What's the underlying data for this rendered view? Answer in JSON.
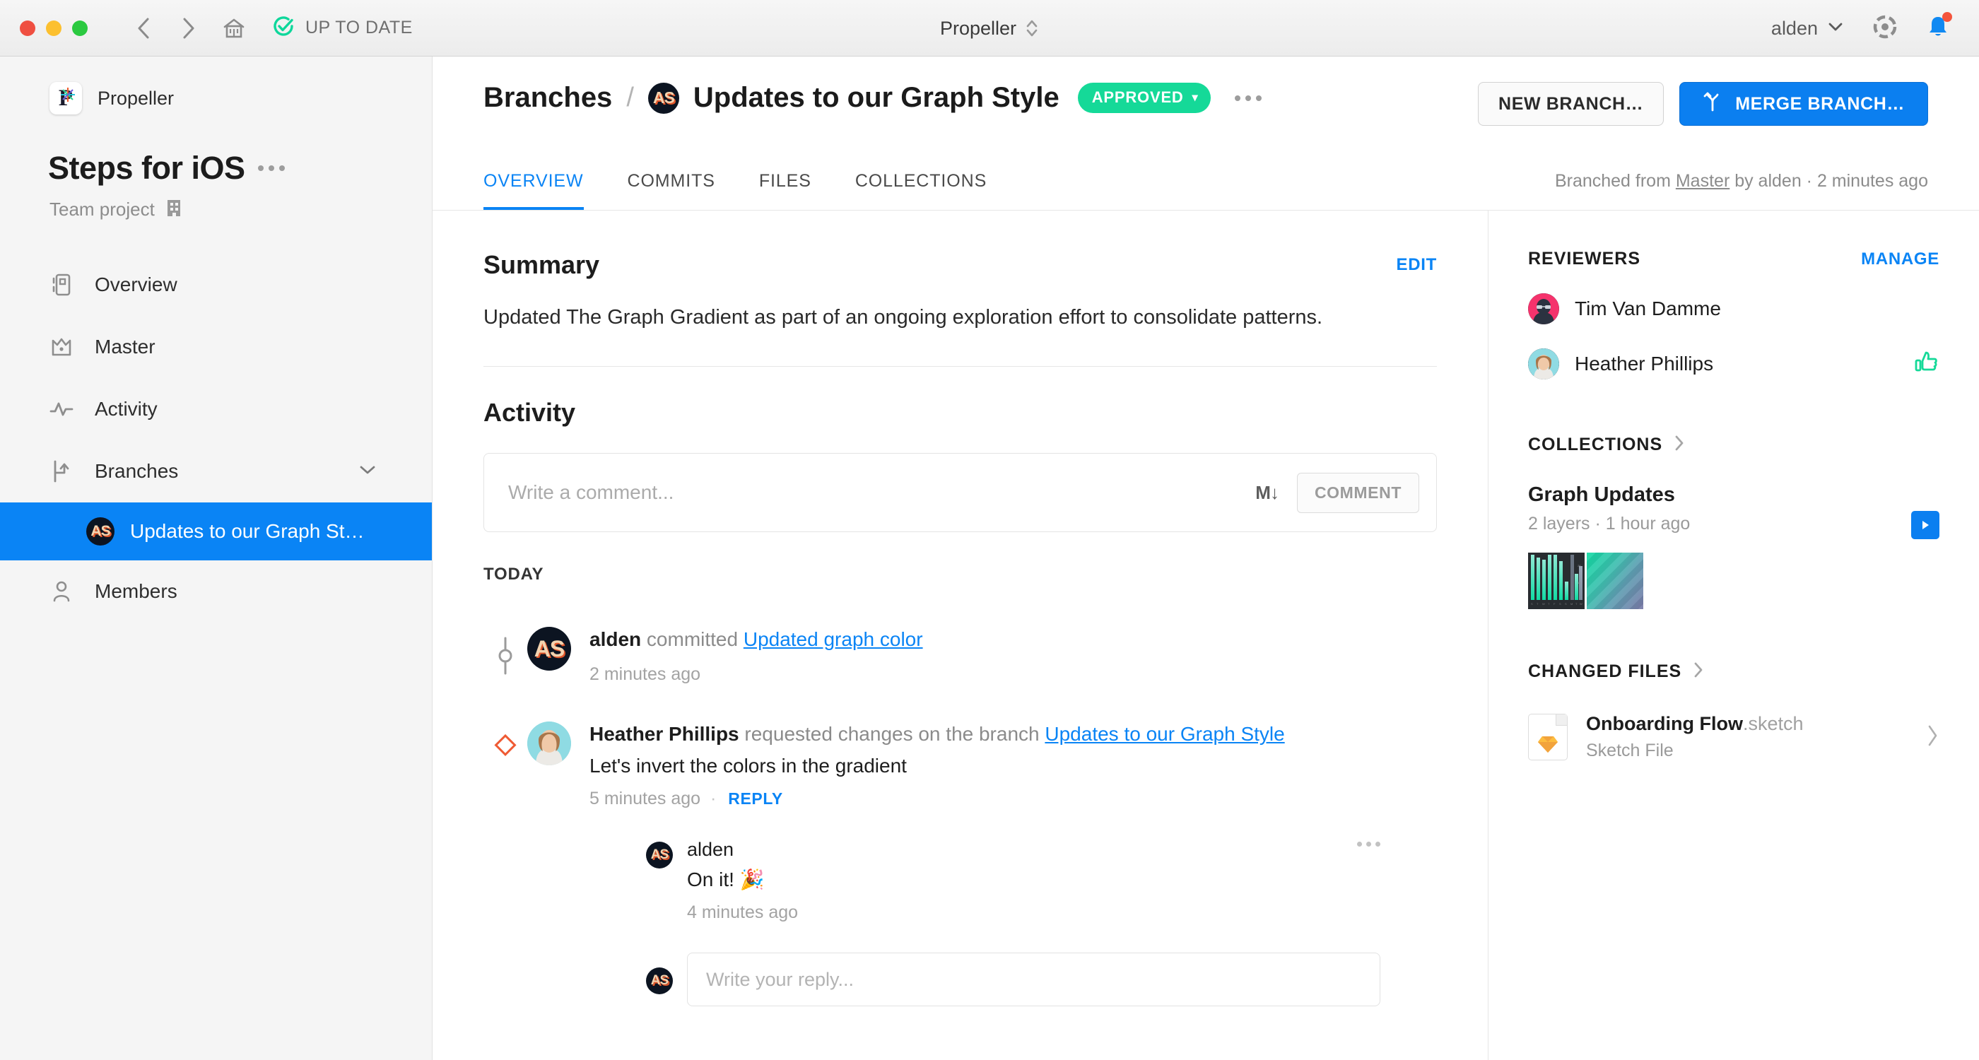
{
  "titlebar": {
    "status_label": "UP TO DATE",
    "window_title": "Propeller",
    "user": "alden",
    "icons": [
      "close-icon",
      "minimize-icon",
      "maximize-icon",
      "back-icon",
      "forward-icon",
      "home-icon",
      "up-to-date-check-icon",
      "stepper-icon",
      "chevron-down-icon",
      "help-icon",
      "notification-bell-icon"
    ]
  },
  "sidebar": {
    "brand": "Propeller",
    "project_title": "Steps for iOS",
    "project_subtitle": "Team project",
    "items": [
      {
        "label": "Overview",
        "icon": "overview-icon"
      },
      {
        "label": "Master",
        "icon": "crown-icon"
      },
      {
        "label": "Activity",
        "icon": "pulse-icon"
      },
      {
        "label": "Branches",
        "icon": "branch-icon",
        "chevron": "chevron-down-icon"
      },
      {
        "label": "Updates to our Graph St…",
        "icon": "avatar-as",
        "active": true
      },
      {
        "label": "Members",
        "icon": "person-icon"
      }
    ]
  },
  "header": {
    "breadcrumb_root": "Branches",
    "breadcrumb_sep": "/",
    "branch_title": "Updates to our Graph Style",
    "status_badge": "APPROVED",
    "status_badge_caret": "▾",
    "more_menu": "more-options-icon",
    "new_branch_label": "NEW BRANCH…",
    "merge_branch_label": "MERGE BRANCH…",
    "tabs": [
      {
        "label": "OVERVIEW",
        "active": true
      },
      {
        "label": "COMMITS",
        "active": false
      },
      {
        "label": "FILES",
        "active": false
      },
      {
        "label": "COLLECTIONS",
        "active": false
      }
    ],
    "branched_prefix": "Branched from ",
    "branched_source": "Master",
    "branched_suffix": " by alden · 2 minutes ago"
  },
  "summary": {
    "title": "Summary",
    "edit_label": "EDIT",
    "body": "Updated The Graph Gradient as part of an ongoing exploration effort to consolidate patterns."
  },
  "activity": {
    "title": "Activity",
    "comment_placeholder": "Write a comment...",
    "markdown_icon": "M↓",
    "comment_button": "COMMENT",
    "day_group": "TODAY",
    "items": [
      {
        "marker": "commit-icon",
        "avatar": "avatar-as",
        "actor": "alden",
        "verb": " committed ",
        "link": "Updated graph color",
        "time": "2 minutes ago"
      },
      {
        "marker": "request-changes-icon",
        "avatar": "avatar-heather",
        "actor": "Heather Phillips",
        "verb": " requested changes on the branch ",
        "link": "Updates to our Graph Style",
        "text": "Let's invert the colors in the gradient",
        "time": "5 minutes ago",
        "reply_label": "REPLY",
        "reply": {
          "avatar": "avatar-as",
          "actor": "alden",
          "text": "On it! 🎉",
          "time": "4 minutes ago",
          "more": "more-options-icon",
          "reply_placeholder": "Write your reply..."
        }
      }
    ]
  },
  "rightpanel": {
    "reviewers": {
      "title": "REVIEWERS",
      "manage_label": "MANAGE",
      "list": [
        {
          "name": "Tim Van Damme",
          "approved": false
        },
        {
          "name": "Heather Phillips",
          "approved": true
        }
      ]
    },
    "collections": {
      "title": "COLLECTIONS",
      "chevron": "chevron-right-icon",
      "name": "Graph Updates",
      "meta": "2 layers · 1 hour ago",
      "play_icon": "play-icon"
    },
    "changed_files": {
      "title": "CHANGED FILES",
      "chevron": "chevron-right-icon",
      "file_name": "Onboarding Flow",
      "file_ext": ".sketch",
      "file_type": "Sketch File",
      "row_chevron": "chevron-right-icon"
    }
  },
  "colors": {
    "accent_blue": "#0a84f5",
    "approved_green": "#15d998",
    "sidebar_bg": "#f5f5f5",
    "traffic_red": "#ef4f41",
    "traffic_yellow": "#fcc02f",
    "traffic_green": "#2bc940"
  }
}
